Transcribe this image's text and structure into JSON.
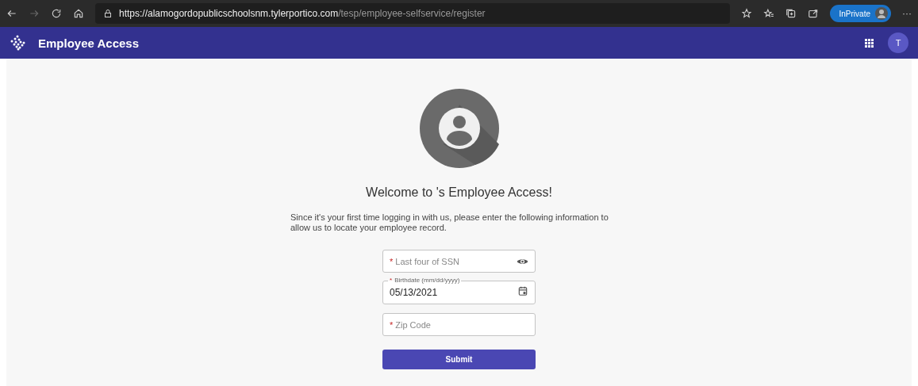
{
  "browser": {
    "url_host": "https://alamogordopublicschoolsnm.tylerportico.com",
    "url_path": "/tesp/employee-selfservice/register",
    "inprivate": "InPrivate",
    "more": "···"
  },
  "app_bar": {
    "title": "Employee Access",
    "avatar": "T"
  },
  "welcome": {
    "title": "Welcome to 's Employee Access!",
    "text": "Since it's your first time logging in with us, please enter the following information to allow us to locate your employee record."
  },
  "fields": [
    {
      "kind": "password",
      "marker": "*",
      "placeholder": "Last four of SSN"
    },
    {
      "kind": "date",
      "marker": "*",
      "label": "Birthdate (mm/dd/yyyy)",
      "value": "05/13/2021"
    },
    {
      "kind": "text",
      "marker": "*",
      "placeholder": "Zip Code"
    }
  ],
  "submit": "Submit"
}
